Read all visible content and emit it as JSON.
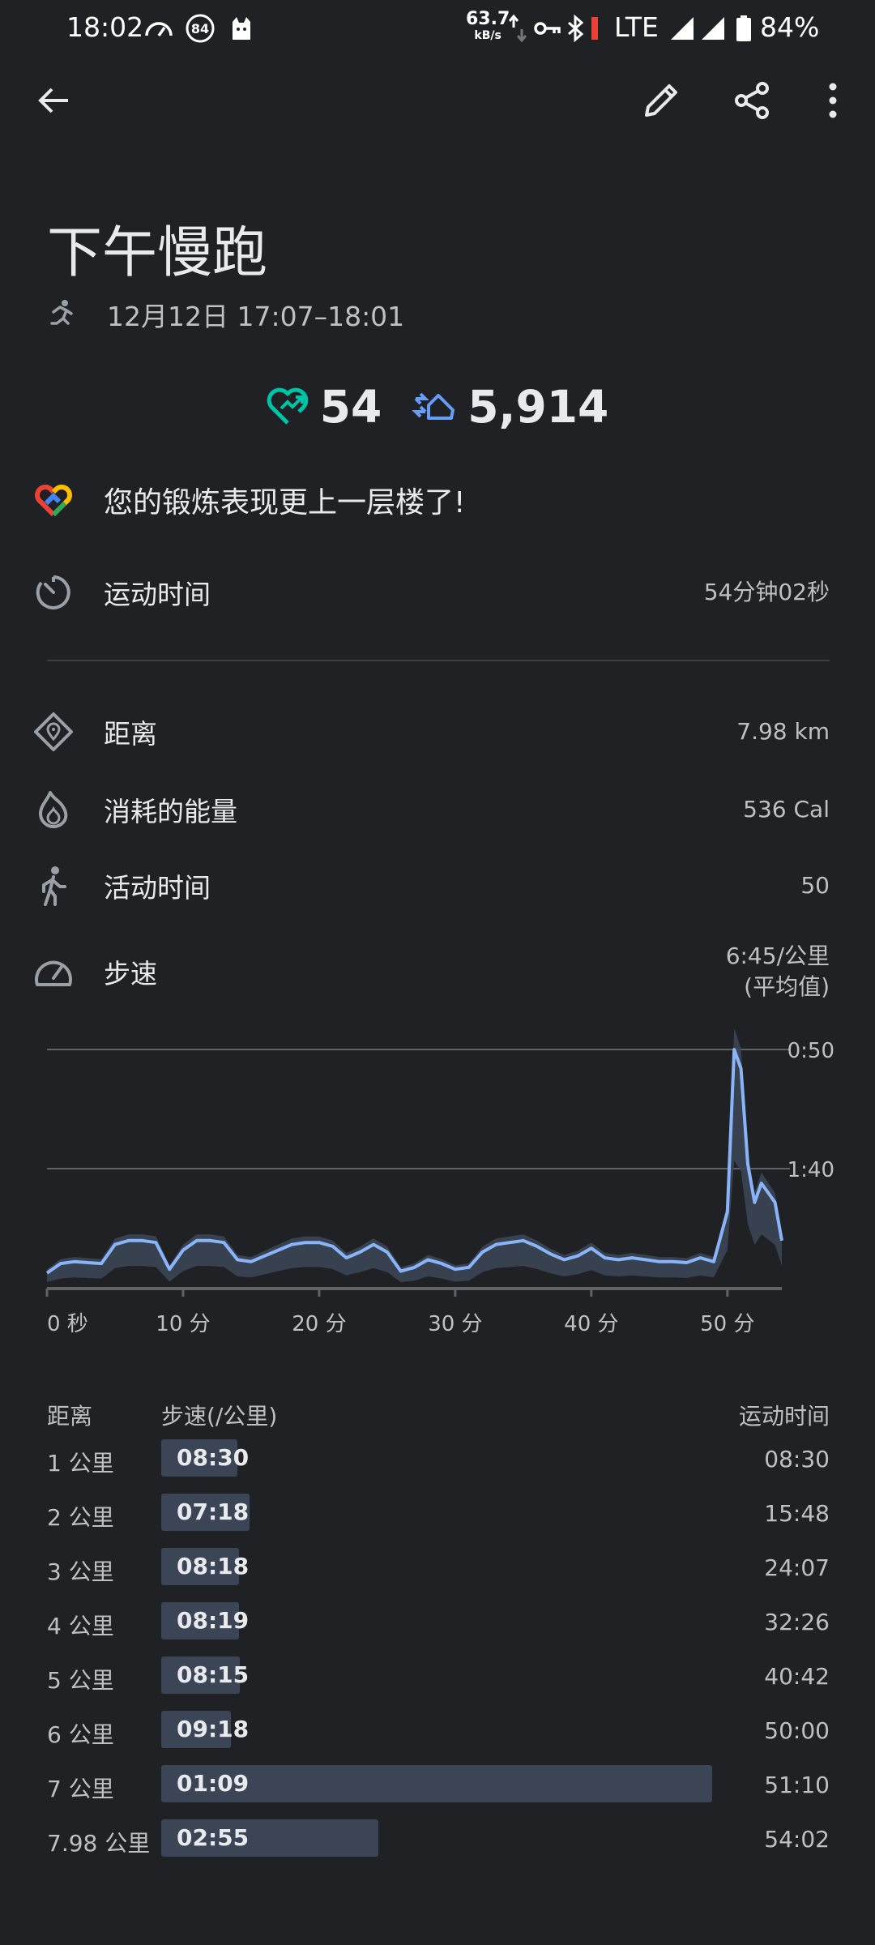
{
  "status_bar": {
    "time": "18:02",
    "badge_count": "84",
    "net_speed": "63.7",
    "net_unit": "kB/s",
    "network": "LTE",
    "battery": "84%"
  },
  "workout": {
    "title": "下午慢跑",
    "datetime": "12月12日 17:07–18:01",
    "heart_points": "54",
    "steps": "5,914",
    "achievement": "您的锻炼表现更上一层楼了!"
  },
  "stats": {
    "duration": {
      "label": "运动时间",
      "value": "54分钟02秒"
    },
    "distance": {
      "label": "距离",
      "value": "7.98 km"
    },
    "energy": {
      "label": "消耗的能量",
      "value": "536 Cal"
    },
    "move_minutes": {
      "label": "活动时间",
      "value": "50"
    },
    "pace": {
      "label": "步速",
      "value_line1": "6:45/公里",
      "value_line2": "(平均值)"
    }
  },
  "chart_data": {
    "type": "area",
    "x_tick_labels": [
      "0 秒",
      "10 分",
      "20 分",
      "30 分",
      "40 分",
      "50 分"
    ],
    "y_tick_labels": [
      "0:50",
      "1:40"
    ],
    "xlim": [
      0,
      54
    ],
    "series": [
      {
        "values": [
          {
            "x": 0,
            "y": 0.3
          },
          {
            "x": 1,
            "y": 0.8
          },
          {
            "x": 2,
            "y": 0.9
          },
          {
            "x": 3,
            "y": 0.85
          },
          {
            "x": 4,
            "y": 0.8
          },
          {
            "x": 5,
            "y": 1.8
          },
          {
            "x": 6,
            "y": 2.0
          },
          {
            "x": 7,
            "y": 2.0
          },
          {
            "x": 8,
            "y": 1.9
          },
          {
            "x": 9,
            "y": 0.5
          },
          {
            "x": 10,
            "y": 1.5
          },
          {
            "x": 11,
            "y": 2.0
          },
          {
            "x": 12,
            "y": 2.0
          },
          {
            "x": 13,
            "y": 1.9
          },
          {
            "x": 14,
            "y": 1.0
          },
          {
            "x": 15,
            "y": 0.9
          },
          {
            "x": 16,
            "y": 1.2
          },
          {
            "x": 17,
            "y": 1.5
          },
          {
            "x": 18,
            "y": 1.8
          },
          {
            "x": 19,
            "y": 1.9
          },
          {
            "x": 20,
            "y": 1.9
          },
          {
            "x": 21,
            "y": 1.7
          },
          {
            "x": 22,
            "y": 1.1
          },
          {
            "x": 23,
            "y": 1.4
          },
          {
            "x": 24,
            "y": 1.8
          },
          {
            "x": 25,
            "y": 1.4
          },
          {
            "x": 26,
            "y": 0.4
          },
          {
            "x": 27,
            "y": 0.6
          },
          {
            "x": 28,
            "y": 1.0
          },
          {
            "x": 29,
            "y": 0.8
          },
          {
            "x": 30,
            "y": 0.5
          },
          {
            "x": 31,
            "y": 0.6
          },
          {
            "x": 32,
            "y": 1.4
          },
          {
            "x": 33,
            "y": 1.8
          },
          {
            "x": 34,
            "y": 1.9
          },
          {
            "x": 35,
            "y": 2.0
          },
          {
            "x": 36,
            "y": 1.7
          },
          {
            "x": 37,
            "y": 1.3
          },
          {
            "x": 38,
            "y": 1.0
          },
          {
            "x": 39,
            "y": 1.2
          },
          {
            "x": 40,
            "y": 1.6
          },
          {
            "x": 41,
            "y": 1.1
          },
          {
            "x": 42,
            "y": 1.0
          },
          {
            "x": 43,
            "y": 1.1
          },
          {
            "x": 44,
            "y": 1.0
          },
          {
            "x": 45,
            "y": 0.9
          },
          {
            "x": 46,
            "y": 0.9
          },
          {
            "x": 47,
            "y": 0.85
          },
          {
            "x": 48,
            "y": 1.1
          },
          {
            "x": 49,
            "y": 0.9
          },
          {
            "x": 50,
            "y": 3.5
          },
          {
            "x": 50.5,
            "y": 12.0
          },
          {
            "x": 51,
            "y": 11.0
          },
          {
            "x": 51.5,
            "y": 6.0
          },
          {
            "x": 52,
            "y": 4.0
          },
          {
            "x": 52.5,
            "y": 5.0
          },
          {
            "x": 53,
            "y": 4.5
          },
          {
            "x": 53.5,
            "y": 4.0
          },
          {
            "x": 54,
            "y": 2.0
          }
        ]
      }
    ],
    "colors": {
      "line": "#8ab4f8",
      "band": "#3b4555",
      "grid": "#5f6368"
    }
  },
  "splits": {
    "headers": {
      "distance": "距离",
      "pace": "步速(/公里)",
      "time": "运动时间"
    },
    "rows": [
      {
        "distance": "1 公里",
        "pace": "08:30",
        "time": "08:30",
        "bar_fraction": 0.138
      },
      {
        "distance": "2 公里",
        "pace": "07:18",
        "time": "15:48",
        "bar_fraction": 0.16
      },
      {
        "distance": "3 公里",
        "pace": "08:18",
        "time": "24:07",
        "bar_fraction": 0.141
      },
      {
        "distance": "4 公里",
        "pace": "08:19",
        "time": "32:26",
        "bar_fraction": 0.141
      },
      {
        "distance": "5 公里",
        "pace": "08:15",
        "time": "40:42",
        "bar_fraction": 0.142
      },
      {
        "distance": "6 公里",
        "pace": "09:18",
        "time": "50:00",
        "bar_fraction": 0.126
      },
      {
        "distance": "7 公里",
        "pace": "01:09",
        "time": "51:10",
        "bar_fraction": 1.0
      },
      {
        "distance": "7.98 公里",
        "pace": "02:55",
        "time": "54:02",
        "bar_fraction": 0.394
      }
    ]
  }
}
